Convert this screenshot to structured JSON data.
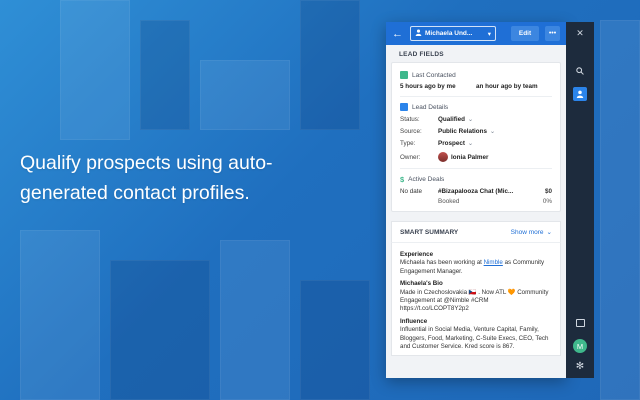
{
  "promo": {
    "headline": "Qualify prospects using auto-generated contact profiles."
  },
  "header": {
    "contact_name": "Michaela Und...",
    "edit_label": "Edit",
    "more_label": "•••"
  },
  "lead_fields": {
    "title": "LEAD FIELDS",
    "last_contacted": {
      "title": "Last Contacted",
      "by_me": "5 hours ago by me",
      "by_team": "an hour ago by team"
    },
    "lead_details": {
      "title": "Lead Details",
      "rows": [
        {
          "label": "Status:",
          "value": "Qualified"
        },
        {
          "label": "Source:",
          "value": "Public Relations"
        },
        {
          "label": "Type:",
          "value": "Prospect"
        },
        {
          "label": "Owner:",
          "value": "Ionia Palmer"
        }
      ]
    },
    "active_deals": {
      "title": "Active Deals",
      "date_label": "No date",
      "deal_name": "#Bizapalooza Chat (Mic...",
      "deal_amount": "$0",
      "stage": "Booked",
      "probability": "0%"
    }
  },
  "smart_summary": {
    "title": "SMART SUMMARY",
    "show_more": "Show more",
    "experience_title": "Experience",
    "experience_pre": "Michaela has been working at ",
    "experience_link": "Nimble",
    "experience_post": " as Community Engagement Manager.",
    "bio_title": "Michaela's Bio",
    "bio_text": "Made in Czechoslovakia 🇨🇿 . Now ATL 🧡 Community Engagement at @Nimble #CRM https://t.co/LCOPT8Y2p2",
    "influence_title": "Influence",
    "influence_text": "Influential in Social Media, Venture Capital, Family, Bloggers, Food, Marketing, C-Suite Execs, CEO, Tech and Customer Service. Kred score is 867."
  },
  "rail": {
    "avatar_letter": "M"
  },
  "colors": {
    "primary": "#1f6fd6",
    "rail": "#1d2b3d",
    "accent_green": "#3fb88c"
  }
}
